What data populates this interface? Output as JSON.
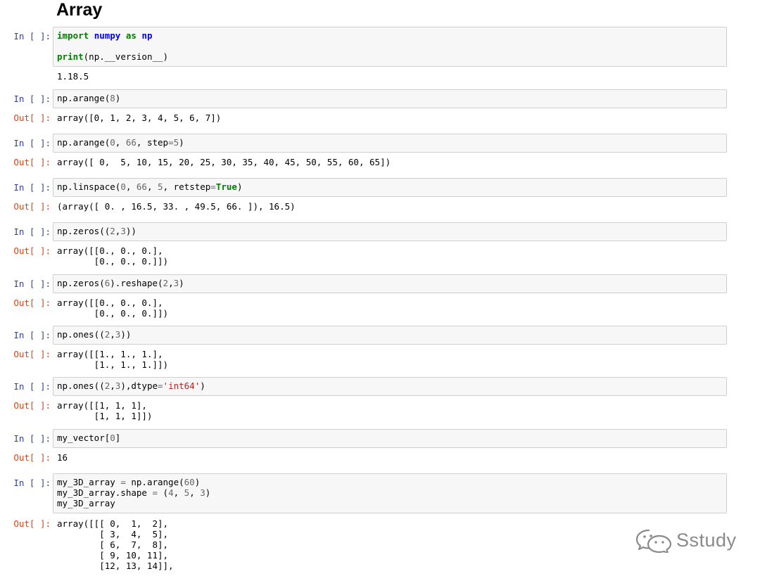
{
  "title": "Array",
  "in_prompt": "In [ ]:",
  "out_prompt": "Out[ ]:",
  "cells": [
    {
      "input": [
        [
          {
            "t": "import",
            "c": "kw"
          },
          {
            "t": " "
          },
          {
            "t": "numpy",
            "c": "nm"
          },
          {
            "t": " "
          },
          {
            "t": "as",
            "c": "kw"
          },
          {
            "t": " "
          },
          {
            "t": "np",
            "c": "nm"
          }
        ],
        [
          {
            "t": ""
          }
        ],
        [
          {
            "t": "print",
            "c": "kw"
          },
          {
            "t": "(np.__version__)"
          }
        ]
      ],
      "output": "1.18.5"
    },
    {
      "input": [
        [
          {
            "t": "np.arange("
          },
          {
            "t": "8",
            "c": "num"
          },
          {
            "t": ")"
          }
        ]
      ],
      "output": "array([0, 1, 2, 3, 4, 5, 6, 7])"
    },
    {
      "input": [
        [
          {
            "t": "np.arange("
          },
          {
            "t": "0",
            "c": "num"
          },
          {
            "t": ", "
          },
          {
            "t": "66",
            "c": "num"
          },
          {
            "t": ", step"
          },
          {
            "t": "=",
            "c": "op"
          },
          {
            "t": "5",
            "c": "num"
          },
          {
            "t": ")"
          }
        ]
      ],
      "output": "array([ 0,  5, 10, 15, 20, 25, 30, 35, 40, 45, 50, 55, 60, 65])"
    },
    {
      "input": [
        [
          {
            "t": "np.linspace("
          },
          {
            "t": "0",
            "c": "num"
          },
          {
            "t": ", "
          },
          {
            "t": "66",
            "c": "num"
          },
          {
            "t": ", "
          },
          {
            "t": "5",
            "c": "num"
          },
          {
            "t": ", retstep"
          },
          {
            "t": "=",
            "c": "op"
          },
          {
            "t": "True",
            "c": "kw"
          },
          {
            "t": ")"
          }
        ]
      ],
      "output": "(array([ 0. , 16.5, 33. , 49.5, 66. ]), 16.5)"
    },
    {
      "input": [
        [
          {
            "t": "np.zeros(("
          },
          {
            "t": "2",
            "c": "num"
          },
          {
            "t": ","
          },
          {
            "t": "3",
            "c": "num"
          },
          {
            "t": "))"
          }
        ]
      ],
      "output": "array([[0., 0., 0.],\n       [0., 0., 0.]])"
    },
    {
      "input": [
        [
          {
            "t": "np.zeros("
          },
          {
            "t": "6",
            "c": "num"
          },
          {
            "t": ").reshape("
          },
          {
            "t": "2",
            "c": "num"
          },
          {
            "t": ","
          },
          {
            "t": "3",
            "c": "num"
          },
          {
            "t": ")"
          }
        ]
      ],
      "output": "array([[0., 0., 0.],\n       [0., 0., 0.]])"
    },
    {
      "input": [
        [
          {
            "t": "np.ones(("
          },
          {
            "t": "2",
            "c": "num"
          },
          {
            "t": ","
          },
          {
            "t": "3",
            "c": "num"
          },
          {
            "t": "))"
          }
        ]
      ],
      "output": "array([[1., 1., 1.],\n       [1., 1., 1.]])"
    },
    {
      "input": [
        [
          {
            "t": "np.ones(("
          },
          {
            "t": "2",
            "c": "num"
          },
          {
            "t": ","
          },
          {
            "t": "3",
            "c": "num"
          },
          {
            "t": "),dtype"
          },
          {
            "t": "=",
            "c": "op"
          },
          {
            "t": "'int64'",
            "c": "str"
          },
          {
            "t": ")"
          }
        ]
      ],
      "output": "array([[1, 1, 1],\n       [1, 1, 1]])"
    },
    {
      "input": [
        [
          {
            "t": "my_vector["
          },
          {
            "t": "0",
            "c": "num"
          },
          {
            "t": "]"
          }
        ]
      ],
      "output": "16"
    },
    {
      "input": [
        [
          {
            "t": "my_3D_array "
          },
          {
            "t": "=",
            "c": "op"
          },
          {
            "t": " np.arange("
          },
          {
            "t": "60",
            "c": "num"
          },
          {
            "t": ")"
          }
        ],
        [
          {
            "t": "my_3D_array.shape "
          },
          {
            "t": "=",
            "c": "op"
          },
          {
            "t": " ("
          },
          {
            "t": "4",
            "c": "num"
          },
          {
            "t": ", "
          },
          {
            "t": "5",
            "c": "num"
          },
          {
            "t": ", "
          },
          {
            "t": "3",
            "c": "num"
          },
          {
            "t": ")"
          }
        ],
        [
          {
            "t": "my_3D_array"
          }
        ]
      ],
      "output": "array([[[ 0,  1,  2],\n        [ 3,  4,  5],\n        [ 6,  7,  8],\n        [ 9, 10, 11],\n        [12, 13, 14]],"
    }
  ],
  "watermark": {
    "text": "Sstudy",
    "icon": "wechat-icon"
  }
}
